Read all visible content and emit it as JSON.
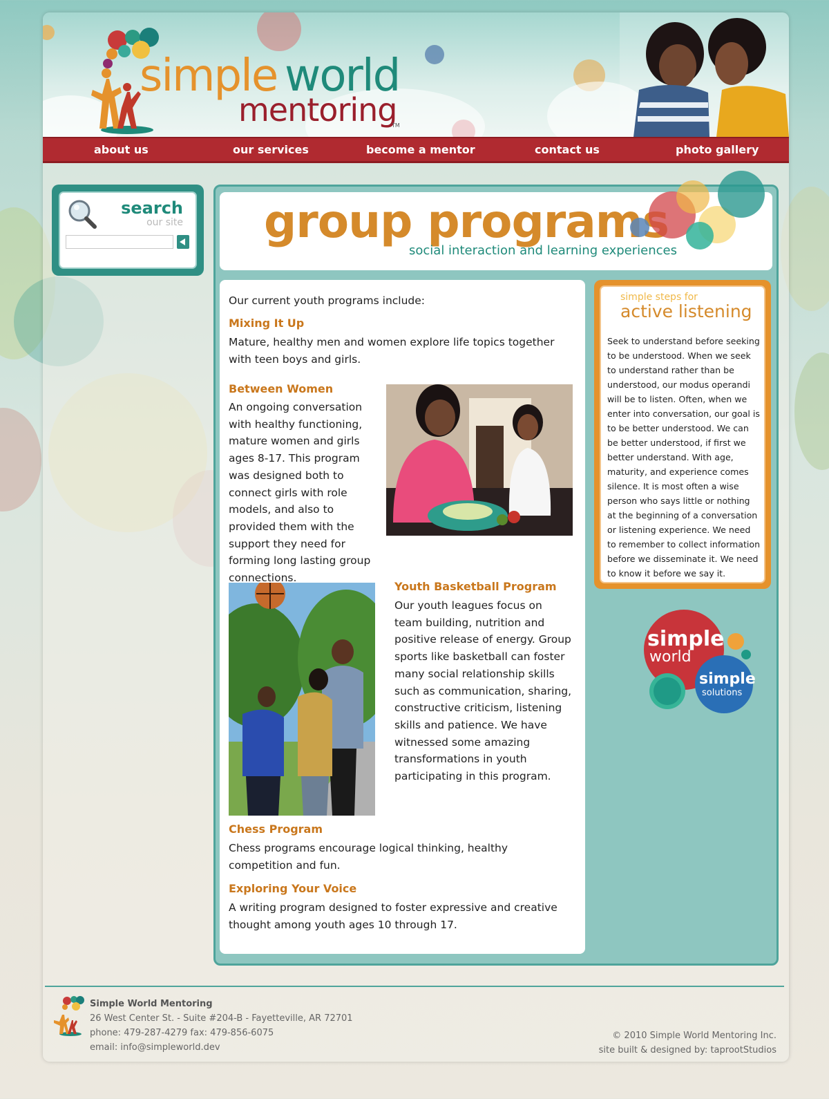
{
  "header": {
    "logo_simple": "simple",
    "logo_world": "world",
    "logo_mentoring": "mentoring",
    "trademark": "TM"
  },
  "nav": {
    "items": [
      "about us",
      "our services",
      "become a mentor",
      "contact us",
      "photo gallery"
    ]
  },
  "search": {
    "title": "search",
    "subtitle": "our site",
    "input_value": "",
    "submit_icon": "play-arrow-icon"
  },
  "banner": {
    "title": "group programs",
    "subtitle": "social interaction and learning experiences"
  },
  "content": {
    "intro": "Our current youth programs include:",
    "programs": [
      {
        "title": "Mixing It Up",
        "text": "Mature, healthy men and women explore life topics together with teen boys and girls."
      },
      {
        "title": "Between Women",
        "text": "An ongoing conversation with healthy functioning, mature women and girls ages 8-17. This program was designed both to connect girls with role models, and also to provided them with the support they need for forming long lasting group connections."
      },
      {
        "title": "Youth Basketball Program",
        "text": "Our youth leagues focus on team building, nutrition and positive release of energy. Group sports like basketball can foster many social relationship skills such as communication, sharing, constructive criticism, listening skills and patience. We have witnessed some amazing transformations in youth participating in this program."
      },
      {
        "title": "Chess Program",
        "text": "Chess programs encourage logical thinking, healthy competition and fun."
      },
      {
        "title": "Exploring Your Voice",
        "text": "A writing program designed to foster expressive and creative thought among youth ages 10 through 17."
      }
    ]
  },
  "sidebar": {
    "kicker": "simple steps for",
    "title": "active listening",
    "body": "Seek to understand before seeking to be understood. When we seek to understand rather than be understood, our modus operandi will be to listen. Often, when we enter into conversation, our goal is to be better understood. We can be better understood, if first we better understand. With age, maturity, and experience comes silence. It is most often a wise person who says little or nothing at the beginning of a conversation or listening experience. We need to remember to collect information before we disseminate it. We need to know it before we say it."
  },
  "badge": {
    "simple": "simple",
    "world": "world",
    "simple2": "simple",
    "solutions": "solutions"
  },
  "footer": {
    "org": "Simple World Mentoring",
    "address": "26 West Center St. - Suite #204-B - Fayetteville, AR 72701",
    "phone": "phone: 479-287-4279 fax: 479-856-6075",
    "email": "email: info@simpleworld.dev",
    "copyright": "© 2010 Simple World Mentoring Inc.",
    "credit": "site built & designed by: taprootStudios"
  },
  "colors": {
    "nav_red": "#b02a30",
    "teal": "#8ec6c0",
    "orange_heading": "#c9771c",
    "sidebox_orange": "#e5922c",
    "logo_green": "#1f8a7a",
    "logo_maroon": "#9a1f2c"
  }
}
